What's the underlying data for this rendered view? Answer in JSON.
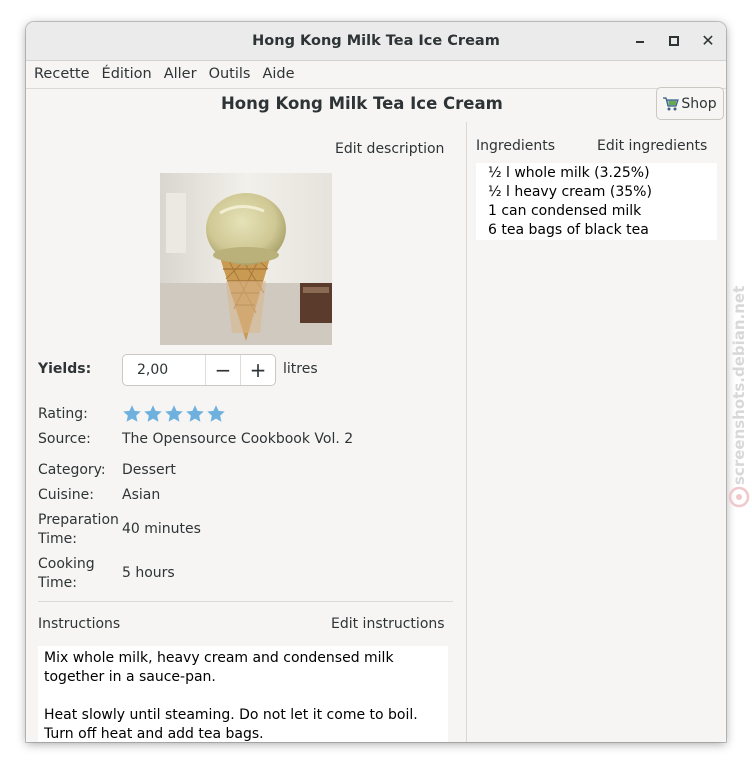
{
  "window": {
    "title": "Hong Kong Milk Tea Ice Cream"
  },
  "menu": [
    "Recette",
    "Édition",
    "Aller",
    "Outils",
    "Aide"
  ],
  "recipe": {
    "title": "Hong Kong Milk Tea Ice Cream",
    "shop_label": "Shop",
    "edit_description_label": "Edit description",
    "yields_label": "Yields:",
    "yields_value": "2,00",
    "yields_unit": "litres",
    "rating_label": "Rating:",
    "rating_stars": 5,
    "source_label": "Source:",
    "source_value": "The Opensource Cookbook Vol. 2",
    "category_label": "Category:",
    "category_value": "Dessert",
    "cuisine_label": "Cuisine:",
    "cuisine_value": "Asian",
    "prep_label_1": "Preparation",
    "prep_label_2": "Time:",
    "prep_value": "40 minutes",
    "cook_label_1": "Cooking",
    "cook_label_2": "Time:",
    "cook_value": "5 hours"
  },
  "instructions": {
    "label": "Instructions",
    "edit_label": "Edit instructions",
    "lines": [
      "Mix whole milk, heavy cream and condensed milk together in a sauce-pan.",
      "Heat slowly until steaming. Do not let it come to boil.",
      "Turn off heat and add tea bags."
    ]
  },
  "ingredients": {
    "label": "Ingredients",
    "edit_label": "Edit ingredients",
    "items": [
      "½ l whole milk (3.25%)",
      "½ l heavy cream (35%)",
      "1 can condensed milk",
      "6 tea bags of black tea"
    ]
  },
  "watermark": "screenshots.debian.net",
  "colors": {
    "star": "#6fb1de",
    "title_bar": "#ebebeb",
    "window_bg": "#f6f5f4"
  }
}
